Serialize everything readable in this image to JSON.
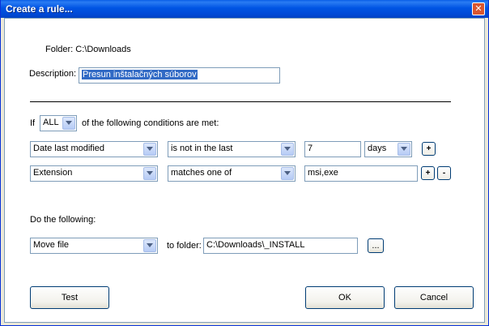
{
  "window": {
    "title": "Create a rule...",
    "close_glyph": "✕"
  },
  "folder": {
    "text": "Folder: C:\\Downloads"
  },
  "description": {
    "label": "Description:",
    "value": "Presun inštalačných súborov"
  },
  "conditions": {
    "if_label": "If",
    "match_mode": "ALL",
    "suffix_label": "of the following conditions are met:",
    "rows": [
      {
        "field": "Date last modified",
        "operator": "is not in the last",
        "value": "7",
        "unit": "days",
        "add": "+"
      },
      {
        "field": "Extension",
        "operator": "matches one of",
        "value": "msi,exe",
        "add": "+",
        "remove": "-"
      }
    ]
  },
  "actions": {
    "label": "Do the following:",
    "action": "Move file",
    "to_folder_label": "to folder:",
    "folder_value": "C:\\Downloads\\_INSTALL",
    "browse_label": "..."
  },
  "buttons": {
    "test": "Test",
    "ok": "OK",
    "cancel": "Cancel"
  },
  "colors": {
    "titlebar": "#0054e3",
    "border": "#7f9db9",
    "selection": "#316ac5"
  }
}
